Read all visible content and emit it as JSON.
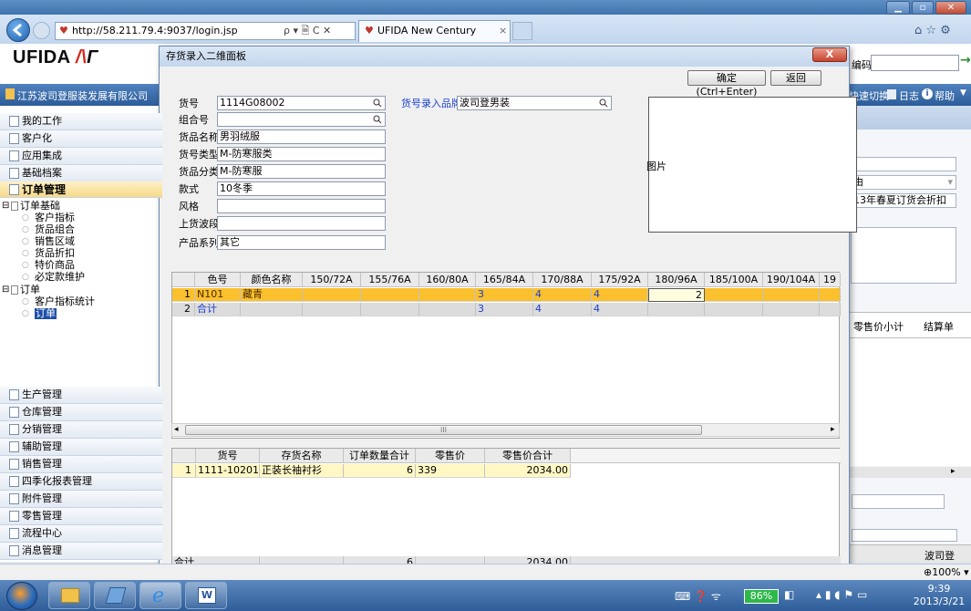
{
  "browser": {
    "address": "http://58.211.79.4:9037/login.jsp",
    "address_controls": "ρ ▾ 🗎 C ✕",
    "tab_title": "UFIDA New Century",
    "tab_close": "×"
  },
  "app": {
    "logo": "UFIDA",
    "company": "江苏波司登服装发展有限公司",
    "right_search_label": "编码",
    "right_nav": "快速切换",
    "log_label": "日志",
    "help_label": "帮助"
  },
  "sidebar": {
    "sections": [
      {
        "label": "我的工作"
      },
      {
        "label": "客户化"
      },
      {
        "label": "应用集成"
      },
      {
        "label": "基础档案"
      },
      {
        "label": "订单管理"
      }
    ],
    "tree": [
      {
        "label": "订单基础",
        "level": 0,
        "expand": "⊟"
      },
      {
        "label": "客户指标",
        "level": 1
      },
      {
        "label": "货品组合",
        "level": 1
      },
      {
        "label": "销售区域",
        "level": 1
      },
      {
        "label": "货品折扣",
        "level": 1
      },
      {
        "label": "特价商品",
        "level": 1
      },
      {
        "label": "必定款维护",
        "level": 1
      },
      {
        "label": "订单",
        "level": 0,
        "expand": "⊟"
      },
      {
        "label": "客户指标统计",
        "level": 1
      },
      {
        "label": "订单",
        "level": 1,
        "selected": true
      }
    ],
    "bottom_sections": [
      {
        "label": "生产管理"
      },
      {
        "label": "仓库管理"
      },
      {
        "label": "分销管理"
      },
      {
        "label": "辅助管理"
      },
      {
        "label": "销售管理"
      },
      {
        "label": "四季化报表管理"
      },
      {
        "label": "附件管理"
      },
      {
        "label": "零售管理"
      },
      {
        "label": "流程中心"
      },
      {
        "label": "消息管理"
      }
    ]
  },
  "background_panel": {
    "reason_prefix": "由",
    "order_meeting": "13年春夏订货会折扣",
    "col_retail_subtotal": "零售价小计",
    "col_settlement": "结算单",
    "footer_text": "波司登"
  },
  "dialog": {
    "title": "存货录入二维面板",
    "close_label": "X",
    "confirm_label": "确定(Ctrl+Enter)",
    "back_label": "返回",
    "fields": {
      "item_no": {
        "label": "货号",
        "value": "1114G08002"
      },
      "combo_no": {
        "label": "组合号",
        "value": ""
      },
      "item_name": {
        "label": "货品名称",
        "value": "男羽绒服"
      },
      "item_type": {
        "label": "货号类型",
        "value": "M-防寒服类"
      },
      "item_category": {
        "label": "货品分类",
        "value": "M-防寒服"
      },
      "style": {
        "label": "款式",
        "value": "10冬季"
      },
      "fashion": {
        "label": "风格",
        "value": ""
      },
      "wave": {
        "label": "上货波段",
        "value": ""
      },
      "series": {
        "label": "产品系列",
        "value": "其它"
      },
      "brand": {
        "label": "货号录入品牌",
        "value": "波司登男装"
      }
    },
    "image_label": "图片",
    "size_grid": {
      "columns": [
        "",
        "色号",
        "颜色名称",
        "150/72A",
        "155/76A",
        "160/80A",
        "165/84A",
        "170/88A",
        "175/92A",
        "180/96A",
        "185/100A",
        "190/104A",
        "19"
      ],
      "rows": [
        {
          "no": "1",
          "code": "N101",
          "name": "藏青",
          "q150": "",
          "q155": "",
          "q160": "",
          "q165": "3",
          "q170": "4",
          "q175": "4",
          "q180": "2",
          "q185": "",
          "q190": ""
        },
        {
          "no": "2",
          "code": "合计",
          "name": "",
          "q150": "",
          "q155": "",
          "q160": "",
          "q165": "3",
          "q170": "4",
          "q175": "4",
          "q180": "",
          "q185": "",
          "q190": ""
        }
      ],
      "scroll_thumb_label": "III"
    },
    "summary_grid": {
      "columns": [
        "",
        "货号",
        "存货名称",
        "订单数量合计",
        "零售价",
        "零售价合计"
      ],
      "rows": [
        {
          "no": "1",
          "item_no": "1111-10201",
          "item_name": "正装长袖衬衫",
          "qty": "6",
          "price": "339",
          "total": "2034.00"
        }
      ],
      "footer": {
        "label": "合计",
        "qty": "6",
        "total": "2034.00"
      }
    }
  },
  "statusbar": {
    "zoom": "100%"
  },
  "taskbar": {
    "battery": "86%",
    "time": "9:39",
    "date": "2013/3/21"
  }
}
